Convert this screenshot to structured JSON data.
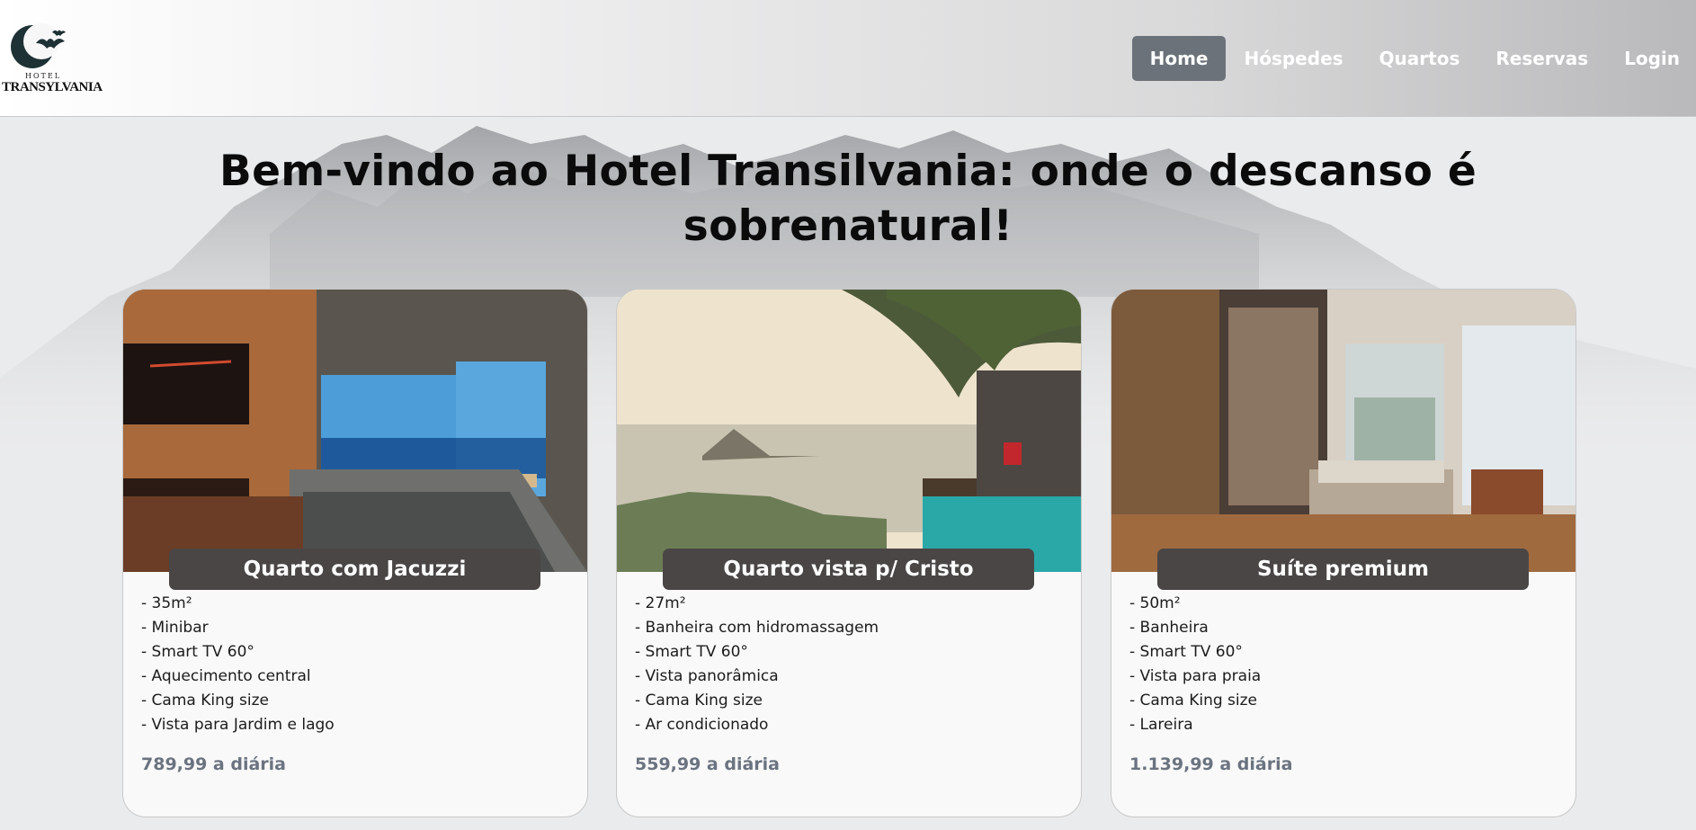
{
  "logo": {
    "line1": "HOTEL",
    "line2": "TRANSYLVANIA"
  },
  "nav": {
    "items": [
      {
        "label": "Home"
      },
      {
        "label": "Hóspedes"
      },
      {
        "label": "Quartos"
      },
      {
        "label": "Reservas"
      },
      {
        "label": "Login"
      }
    ],
    "active": "Home"
  },
  "hero": {
    "title_line1": "Bem-vindo ao Hotel Transilvania: onde o descanso é",
    "title_line2": "sobrenatural!"
  },
  "rooms": [
    {
      "name": "Quarto com Jacuzzi",
      "features": [
        "- 35m²",
        "- Minibar",
        "- Smart TV 60°",
        "- Aquecimento central",
        "- Cama King size",
        "- Vista para Jardim e lago"
      ],
      "price": "789,99 a diária"
    },
    {
      "name": "Quarto vista p/ Cristo",
      "features": [
        "- 27m²",
        "- Banheira com hidromassagem",
        "- Smart TV 60°",
        "- Vista panorâmica",
        "- Cama King size",
        "- Ar condicionado"
      ],
      "price": "559,99 a diária"
    },
    {
      "name": "Suíte premium",
      "features": [
        "- 50m²",
        "- Banheira",
        "- Smart TV 60°",
        "- Vista para praia",
        "- Cama King size",
        "- Lareira"
      ],
      "price": "1.139,99 a diária"
    }
  ],
  "colors": {
    "nav_active_bg": "#6c7279",
    "badge_bg": "#4a4646",
    "price_text": "#6b7380"
  }
}
